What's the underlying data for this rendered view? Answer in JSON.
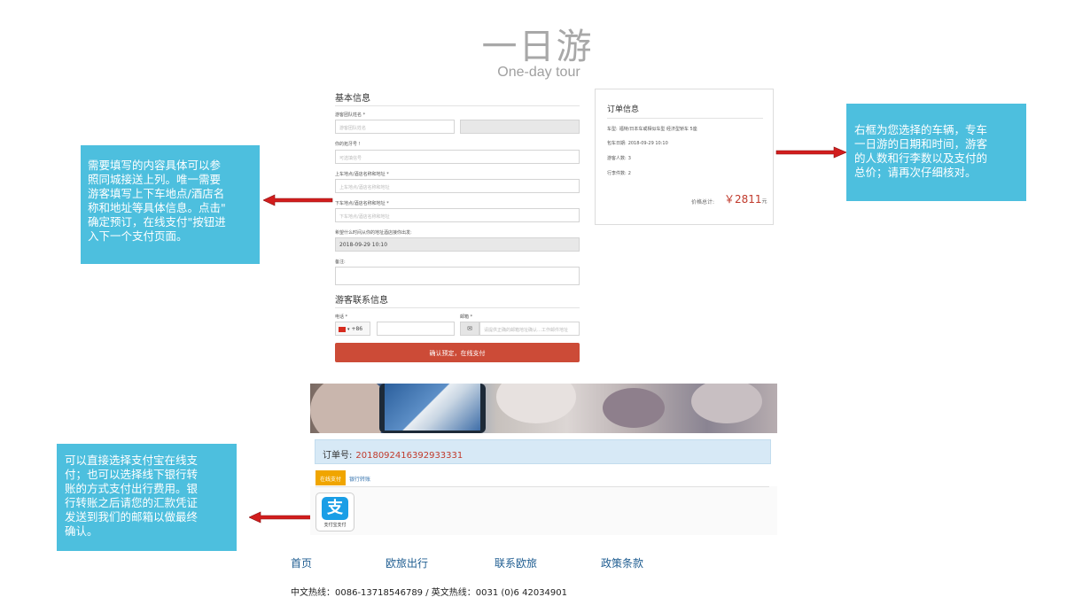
{
  "header": {
    "title": "一日游",
    "subtitle": "One-day tour"
  },
  "form": {
    "section_basic": "基本信息",
    "name_label": "游客团队姓名 *",
    "name_placeholder": "游客团队姓名",
    "passport_label": "你的拓牙号 !",
    "passport_placeholder": "可选填信号",
    "pickup_label": "上车地点/酒店名称和地址 *",
    "pickup_placeholder": "上车地点/酒店名称和地址",
    "dropoff_label": "下车地点/酒店名称和地址 *",
    "dropoff_placeholder": "下车地点/酒店名称和地址",
    "time_label": "希望什么时间从你的地址酒店接你出发:",
    "time_value": "2018-09-29   10:10",
    "remark_label": "备注:",
    "section_contact": "游客联系信息",
    "phone_label": "电话 *",
    "phone_code": "+86",
    "email_label": "邮箱 *",
    "email_placeholder": "请提供正确的邮箱地址确认…工作邮件地址",
    "submit_label": "确认预定，在线支付"
  },
  "order_box": {
    "title": "订单信息",
    "car_label": "车型:",
    "car_value": "福特/日本车或相似车型 经济型轿车 5座",
    "date_label": "包车日期:",
    "date_value": "2018-09-29 10:10",
    "people_label": "游客人数:",
    "people_value": "3",
    "luggage_label": "行李件数:",
    "luggage_value": "2",
    "price_label": "价格总计:",
    "price_value": "￥2811",
    "price_unit": "元"
  },
  "notes": {
    "left_top": [
      "需要填写的内容具体可以参",
      "照同城接送上列。唯一需要",
      "游客填写上下车地点/酒店名",
      "称和地址等具体信息。点击\"",
      "确定预订，在线支付\"按钮进",
      "入下一个支付页面。"
    ],
    "right": [
      "右框为您选择的车辆，专车",
      "一日游的日期和时间，游客",
      "的人数和行李数以及支付的",
      "总价；请再次仔细核对。"
    ],
    "left_bottom": [
      "可以直接选择支付宝在线支",
      "付；也可以选择线下银行转",
      "账的方式支付出行费用。银",
      "行转账之后请您的汇款凭证",
      "发送到我们的邮箱以做最终",
      "确认。"
    ]
  },
  "payment": {
    "order_no_label": "订单号:",
    "order_no_value": "2018092416392933331",
    "tab_online": "在线支付",
    "tab_bank": "银行转账",
    "alipay_symbol": "支",
    "alipay_label": "支付宝支付"
  },
  "footer": {
    "nav": [
      "首页",
      "欧旅出行",
      "联系欧旅",
      "政策条款"
    ],
    "hotline": "中文热线：0086-13718546789 / 英文热线：0031 (0)6 42034901"
  },
  "colors": {
    "accent": "#4dbfde",
    "submit": "#cc4b37",
    "price": "#c0392b",
    "link": "#1f5d91"
  }
}
